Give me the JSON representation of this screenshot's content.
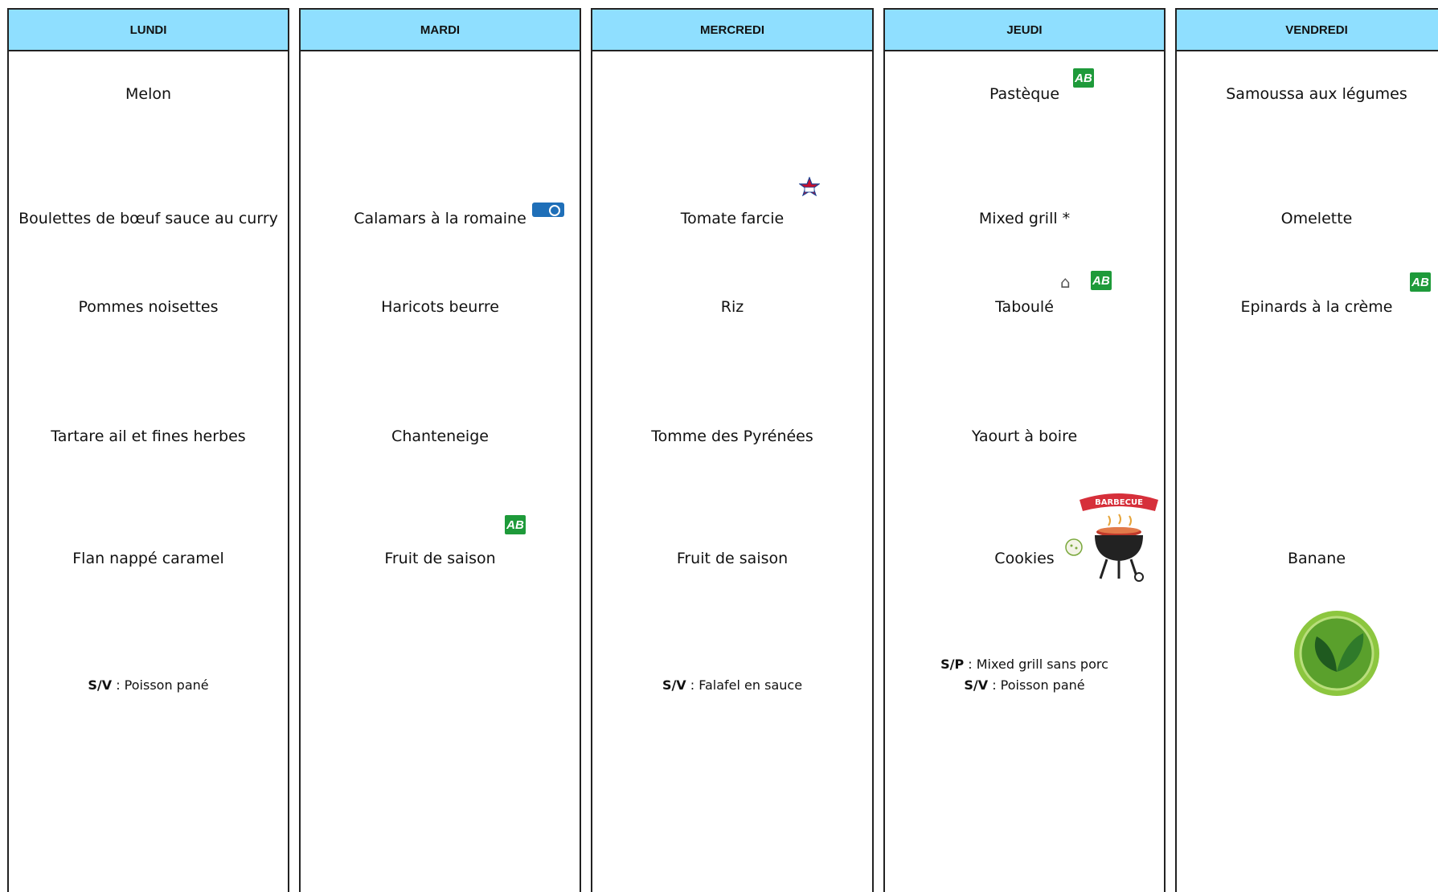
{
  "days": [
    {
      "name": "LUNDI",
      "starter": "Melon",
      "main": "Boulettes de bœuf sauce au curry",
      "side": "Pommes noisettes",
      "dairy": "Tartare ail et fines herbes",
      "dessert": "Flan nappé caramel",
      "alternatives": [
        {
          "code": "S/V",
          "sep": " : ",
          "text": "Poisson pané"
        }
      ]
    },
    {
      "name": "MARDI",
      "starter": "",
      "main": "Calamars à la romaine",
      "side": "Haricots beurre",
      "dairy": "Chanteneige",
      "dessert": "Fruit de saison",
      "alternatives": []
    },
    {
      "name": "MERCREDI",
      "starter": "",
      "main": "Tomate farcie",
      "side": "Riz",
      "dairy": "Tomme des Pyrénées",
      "dessert": "Fruit de saison",
      "alternatives": [
        {
          "code": "S/V",
          "sep": " : ",
          "text": "Falafel en sauce"
        }
      ]
    },
    {
      "name": "JEUDI",
      "starter": "Pastèque",
      "main": "Mixed grill *",
      "side": "Taboulé",
      "dairy": "Yaourt à boire",
      "dessert": "Cookies",
      "alternatives": [
        {
          "code": "S/P",
          "sep": " : ",
          "text": "Mixed grill sans porc"
        },
        {
          "code": "S/V",
          "sep": " : ",
          "text": "Poisson pané"
        }
      ]
    },
    {
      "name": "VENDREDI",
      "starter": "Samoussa aux légumes",
      "main": "Omelette",
      "side": "Epinards à la crème",
      "dairy": "",
      "dessert": "Banane",
      "alternatives": []
    }
  ],
  "badges": {
    "ab_label": "AB",
    "bbq_banner": "BARBECUE",
    "colors": {
      "header": "#8fdfff",
      "ab_green": "#1e9a3a",
      "veg_green": "#5aa02c",
      "msc_blue": "#1f6fb8"
    },
    "icons": [
      "ab-organic-icon",
      "msc-label-icon",
      "viande-bovine-francaise-icon",
      "homemade-icon",
      "barbecue-icon",
      "vegetarian-leaf-icon"
    ]
  }
}
